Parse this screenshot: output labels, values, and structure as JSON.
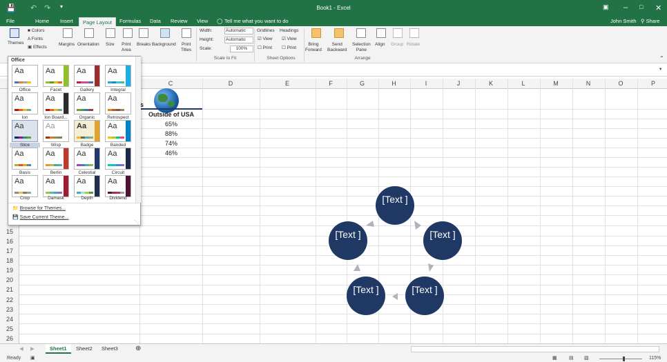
{
  "window": {
    "title": "Book1 - Excel"
  },
  "tabs": [
    "File",
    "Home",
    "Insert",
    "Page Layout",
    "Formulas",
    "Data",
    "Review",
    "View"
  ],
  "tell_me": "Tell me what you want to do",
  "user": {
    "name": "John Smith",
    "share": "Share"
  },
  "ribbon": {
    "themes": "Themes",
    "colors": "Colors",
    "fonts": "Fonts",
    "effects": "Effects",
    "margins": "Margins",
    "orientation": "Orientation",
    "size": "Size",
    "print_area_1": "Print",
    "print_area_2": "Area",
    "breaks": "Breaks",
    "background": "Background",
    "print_titles_1": "Print",
    "print_titles_2": "Titles",
    "width_label": "Width:",
    "width_value": "Automatic",
    "height_label": "Height:",
    "height_value": "Automatic",
    "scale_label": "Scale:",
    "scale_value": "100%",
    "scale_group": "Scale to Fit",
    "gridlines": "Gridlines",
    "headings": "Headings",
    "view": "View",
    "print": "Print",
    "sheet_options": "Sheet Options",
    "bring_forward_1": "Bring",
    "bring_forward_2": "Forward",
    "send_backward_1": "Send",
    "send_backward_2": "Backward",
    "selection_pane_1": "Selection",
    "selection_pane_2": "Pane",
    "align": "Align",
    "group": "Group",
    "rotate": "Rotate",
    "arrange": "Arrange"
  },
  "gallery": {
    "header": "Office",
    "themes": [
      "Office",
      "Facet",
      "Gallery",
      "Integral",
      "Ion",
      "Ion Board...",
      "Organic",
      "Retrospect",
      "Slice",
      "Wisp",
      "Badge",
      "Banded",
      "Basis",
      "Berlin",
      "Celestial",
      "Circuit",
      "Crop",
      "Damask",
      "Depth",
      "Dividend"
    ],
    "sample": "Aa",
    "browse": "Browse for Themes...",
    "save": "Save Current Theme..."
  },
  "columns": [
    "C",
    "D",
    "E",
    "F",
    "G",
    "H",
    "I",
    "J",
    "K",
    "L",
    "M",
    "N",
    "O",
    "P"
  ],
  "rows": [
    "15",
    "16",
    "17",
    "18",
    "19",
    "20",
    "21",
    "22",
    "23",
    "24",
    "25",
    "26"
  ],
  "cells": {
    "c_header": "Outside of USA",
    "values": [
      "65%",
      "88%",
      "74%",
      "46%"
    ],
    "partial_b": "s"
  },
  "smartart": {
    "labels": [
      "[Text ]",
      "[Text ]",
      "[Text ]",
      "[Text ]",
      "[Text ]"
    ]
  },
  "sheets": [
    "Sheet1",
    "Sheet2",
    "Sheet3"
  ],
  "status": {
    "ready": "Ready",
    "zoom": "115%"
  }
}
